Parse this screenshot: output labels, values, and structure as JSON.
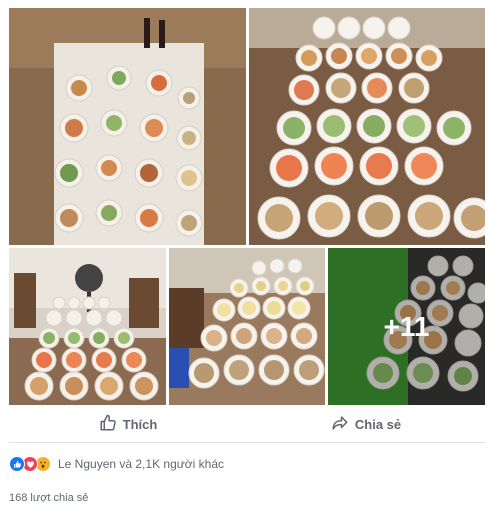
{
  "photos": [
    {
      "id": "p1",
      "alt": ""
    },
    {
      "id": "p2",
      "alt": ""
    },
    {
      "id": "p3",
      "alt": ""
    },
    {
      "id": "p4",
      "alt": ""
    },
    {
      "id": "p5",
      "alt": "",
      "more_label": "+11"
    }
  ],
  "actions": {
    "like_label": "Thích",
    "share_label": "Chia sẻ"
  },
  "reactions": {
    "icons": [
      "like-icon",
      "love-icon",
      "wow-icon"
    ],
    "summary": "Le Nguyen và 2,1K người khác"
  },
  "shares": {
    "count_text": "168 lượt chia sẻ"
  },
  "colors": {
    "like": "#1877f2",
    "love": "#f33e58",
    "wow": "#f7b125",
    "muted_text": "#606770"
  }
}
